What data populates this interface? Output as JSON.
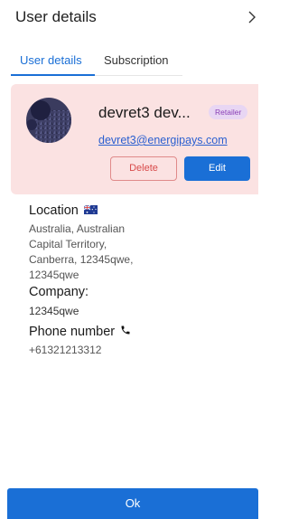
{
  "header": {
    "title": "User details",
    "chevron_icon": "chevron-right-icon"
  },
  "tabs": [
    {
      "label": "User details",
      "active": true
    },
    {
      "label": "Subscription",
      "active": false
    }
  ],
  "user": {
    "name": "devret3 dev...",
    "role_badge": "Retailer",
    "email": "devret3@energipays.com",
    "avatar_icon": "avatar-image",
    "delete_label": "Delete",
    "edit_label": "Edit"
  },
  "location": {
    "label": "Location",
    "flag_icon": "australia-flag-icon",
    "lines": [
      "Australia, Australian",
      "Capital Territory,",
      "Canberra, 12345qwe,",
      "12345qwe"
    ]
  },
  "company": {
    "label": "Company:",
    "value": "12345qwe"
  },
  "phone": {
    "label": "Phone number",
    "icon": "phone-icon",
    "value": "+61321213312"
  },
  "footer": {
    "ok_label": "Ok"
  },
  "colors": {
    "accent": "#1a6fd6",
    "card_bg": "#fbe2e2",
    "danger": "#d84b4b",
    "badge_bg": "#e8d6f3",
    "badge_text": "#8a3fb6"
  }
}
